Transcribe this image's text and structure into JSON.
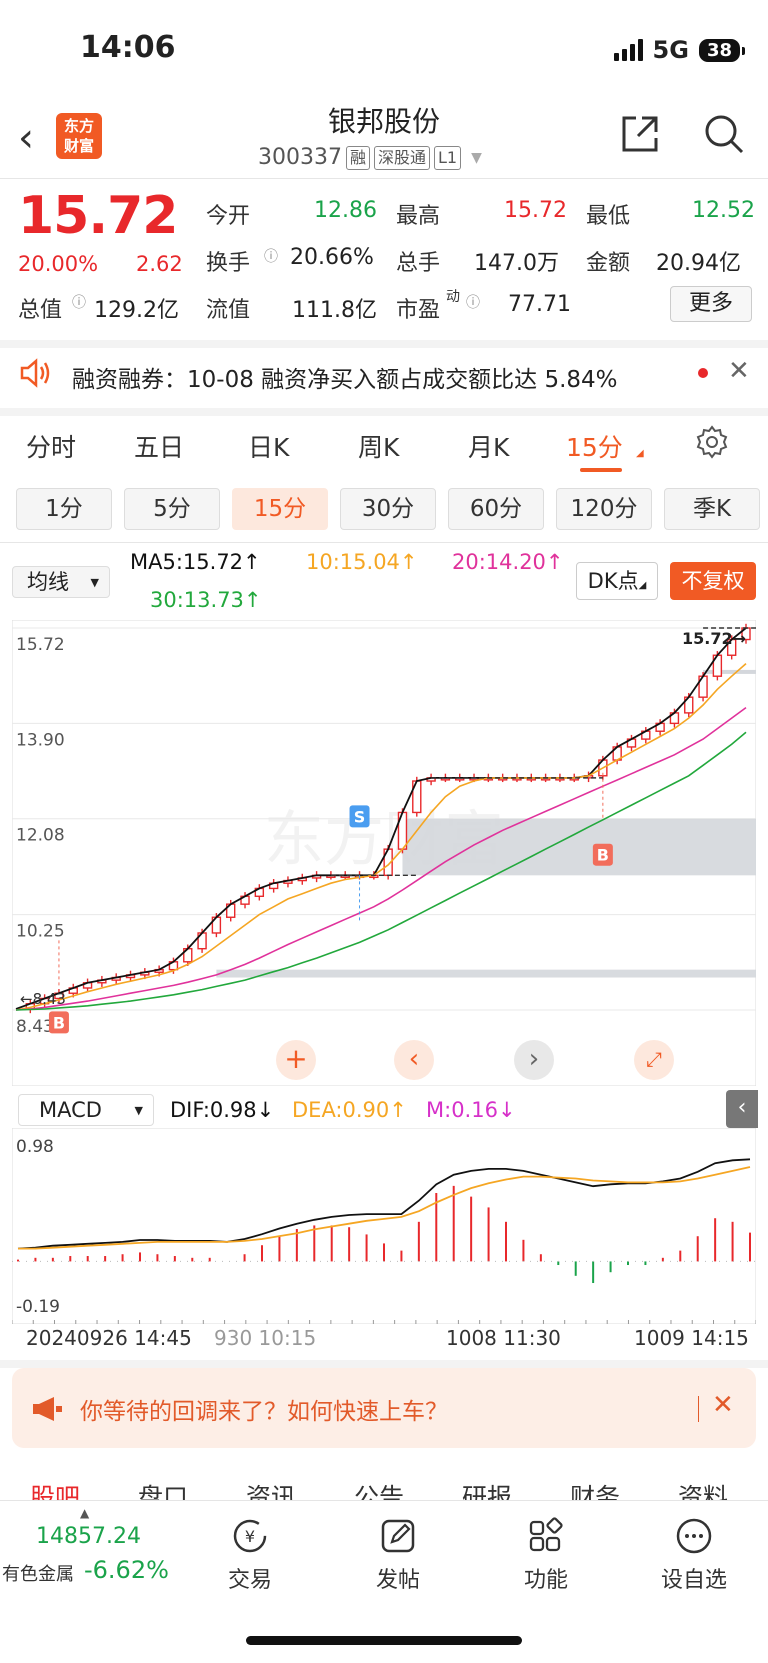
{
  "status": {
    "time": "14:06",
    "network": "5G",
    "battery": "38"
  },
  "header": {
    "logo_text": "东方财富",
    "stock_name": "银邦股份",
    "stock_code": "300337",
    "tags": [
      "融",
      "深股通",
      "L1"
    ]
  },
  "quote": {
    "price": "15.72",
    "pct": "20.00%",
    "change": "2.62",
    "fields": {
      "open_label": "今开",
      "open": "12.86",
      "high_label": "最高",
      "high": "15.72",
      "low_label": "最低",
      "low": "12.52",
      "turnover_label": "换手",
      "turnover": "20.66%",
      "volume_label": "总手",
      "volume": "147.0万",
      "amount_label": "金额",
      "amount": "20.94亿",
      "mktcap_label": "总值",
      "mktcap": "129.2亿",
      "float_label": "流值",
      "float": "111.8亿",
      "pe_label": "市盈",
      "pe_sup": "动",
      "pe": "77.71"
    },
    "more_label": "更多"
  },
  "notice": {
    "text": "融资融券：10-08 融资净买入额占成交额比达 5.84%"
  },
  "period_tabs": [
    "分时",
    "五日",
    "日K",
    "周K",
    "月K",
    "15分"
  ],
  "active_period": "15分",
  "sub_tabs": [
    "1分",
    "5分",
    "15分",
    "30分",
    "60分",
    "120分",
    "季K"
  ],
  "active_sub": "15分",
  "ma": {
    "select_label": "均线",
    "ma5": "MA5:15.72↑",
    "ma10": "10:15.04↑",
    "ma20": "20:14.20↑",
    "ma30": "30:13.73↑",
    "dk_label": "DK点",
    "fq_label": "不复权"
  },
  "colors": {
    "ma5": "#111111",
    "ma10": "#f5a623",
    "ma20": "#e0329b",
    "ma30": "#22a83c",
    "up": "#e8282b",
    "down": "#1aa34a",
    "accent": "#f15a24"
  },
  "chart_data": [
    {
      "type": "candlestick",
      "y_ticks": [
        "15.72",
        "13.90",
        "12.08",
        "10.25",
        "8.43"
      ],
      "ylim": [
        8.43,
        15.72
      ],
      "price_label": "15.72",
      "start_label": "8.43",
      "markers": [
        "B",
        "S",
        "B"
      ],
      "series": [
        {
          "name": "MA5",
          "values": [
            8.45,
            8.55,
            8.65,
            8.75,
            8.85,
            8.95,
            9.0,
            9.05,
            9.1,
            9.15,
            9.2,
            9.35,
            9.6,
            9.9,
            10.2,
            10.45,
            10.6,
            10.75,
            10.85,
            10.9,
            10.95,
            11.0,
            11.0,
            11.0,
            11.0,
            11.0,
            11.5,
            12.2,
            12.8,
            12.86,
            12.86,
            12.86,
            12.86,
            12.86,
            12.86,
            12.86,
            12.86,
            12.86,
            12.86,
            12.86,
            12.9,
            13.2,
            13.45,
            13.6,
            13.75,
            13.9,
            14.1,
            14.4,
            14.8,
            15.2,
            15.5,
            15.72
          ]
        },
        {
          "name": "MA10",
          "values": [
            8.43,
            8.48,
            8.55,
            8.62,
            8.7,
            8.78,
            8.85,
            8.92,
            8.98,
            9.04,
            9.1,
            9.18,
            9.3,
            9.45,
            9.65,
            9.85,
            10.05,
            10.25,
            10.4,
            10.55,
            10.65,
            10.75,
            10.85,
            10.92,
            10.96,
            11.0,
            11.2,
            11.5,
            11.85,
            12.2,
            12.5,
            12.7,
            12.8,
            12.86,
            12.86,
            12.86,
            12.86,
            12.86,
            12.86,
            12.86,
            12.9,
            13.05,
            13.2,
            13.35,
            13.5,
            13.65,
            13.8,
            14.0,
            14.25,
            14.55,
            14.8,
            15.04
          ]
        },
        {
          "name": "MA20",
          "values": [
            8.43,
            8.45,
            8.48,
            8.52,
            8.56,
            8.6,
            8.65,
            8.7,
            8.75,
            8.8,
            8.85,
            8.9,
            8.96,
            9.03,
            9.1,
            9.2,
            9.3,
            9.42,
            9.55,
            9.68,
            9.8,
            9.92,
            10.04,
            10.16,
            10.28,
            10.4,
            10.55,
            10.72,
            10.9,
            11.08,
            11.26,
            11.42,
            11.58,
            11.72,
            11.86,
            11.98,
            12.1,
            12.22,
            12.34,
            12.46,
            12.58,
            12.7,
            12.82,
            12.94,
            13.06,
            13.18,
            13.3,
            13.45,
            13.6,
            13.8,
            14.0,
            14.2
          ]
        },
        {
          "name": "MA30",
          "values": [
            8.43,
            8.44,
            8.45,
            8.47,
            8.49,
            8.51,
            8.54,
            8.57,
            8.6,
            8.64,
            8.68,
            8.72,
            8.77,
            8.82,
            8.88,
            8.94,
            9.0,
            9.08,
            9.16,
            9.24,
            9.33,
            9.42,
            9.52,
            9.62,
            9.72,
            9.84,
            9.96,
            10.1,
            10.24,
            10.38,
            10.52,
            10.66,
            10.8,
            10.94,
            11.08,
            11.22,
            11.36,
            11.5,
            11.64,
            11.78,
            11.92,
            12.06,
            12.2,
            12.34,
            12.48,
            12.62,
            12.76,
            12.9,
            13.1,
            13.3,
            13.5,
            13.73
          ]
        }
      ]
    },
    {
      "type": "macd",
      "indicator_label": "MACD",
      "dif": "DIF:0.98↓",
      "dea": "DEA:0.90↑",
      "m": "M:0.16↓",
      "y_ticks": [
        "0.98",
        "-0.19"
      ],
      "ylim": [
        -0.19,
        0.98
      ],
      "x_labels": [
        "20240926 14:45",
        "930 10:15",
        "1008 11:30",
        "1009 14:15"
      ],
      "series": [
        {
          "name": "DIF",
          "values": [
            0.05,
            0.06,
            0.08,
            0.09,
            0.1,
            0.11,
            0.12,
            0.14,
            0.14,
            0.13,
            0.13,
            0.13,
            0.12,
            0.15,
            0.2,
            0.26,
            0.31,
            0.35,
            0.38,
            0.4,
            0.41,
            0.41,
            0.41,
            0.55,
            0.72,
            0.82,
            0.86,
            0.88,
            0.88,
            0.86,
            0.82,
            0.78,
            0.74,
            0.7,
            0.72,
            0.73,
            0.73,
            0.75,
            0.78,
            0.85,
            0.94,
            0.97,
            0.98
          ]
        },
        {
          "name": "DEA",
          "values": [
            0.05,
            0.05,
            0.06,
            0.07,
            0.08,
            0.09,
            0.1,
            0.11,
            0.12,
            0.12,
            0.12,
            0.12,
            0.12,
            0.13,
            0.15,
            0.18,
            0.21,
            0.25,
            0.28,
            0.31,
            0.34,
            0.36,
            0.38,
            0.44,
            0.53,
            0.61,
            0.68,
            0.73,
            0.77,
            0.8,
            0.8,
            0.79,
            0.78,
            0.76,
            0.75,
            0.74,
            0.74,
            0.74,
            0.75,
            0.78,
            0.82,
            0.86,
            0.9
          ]
        },
        {
          "name": "M",
          "values": [
            0.01,
            0.02,
            0.02,
            0.03,
            0.03,
            0.03,
            0.04,
            0.05,
            0.04,
            0.03,
            0.02,
            0.02,
            0.0,
            0.04,
            0.09,
            0.14,
            0.18,
            0.2,
            0.2,
            0.19,
            0.15,
            0.1,
            0.06,
            0.22,
            0.38,
            0.42,
            0.36,
            0.3,
            0.22,
            0.12,
            0.04,
            -0.02,
            -0.08,
            -0.12,
            -0.06,
            -0.02,
            -0.02,
            0.02,
            0.06,
            0.14,
            0.24,
            0.22,
            0.16
          ]
        }
      ]
    }
  ],
  "banner": {
    "text": "你等待的回调来了？如何快速上车？"
  },
  "bottom_tabs_peek": [
    "股吧",
    "盘口",
    "资讯",
    "公告",
    "研报",
    "财务",
    "资料"
  ],
  "bottom_bar": {
    "index_value": "14857.24",
    "index_name": "有色金属",
    "index_pct": "-6.62%",
    "nav": [
      "交易",
      "发帖",
      "功能",
      "设自选"
    ]
  }
}
